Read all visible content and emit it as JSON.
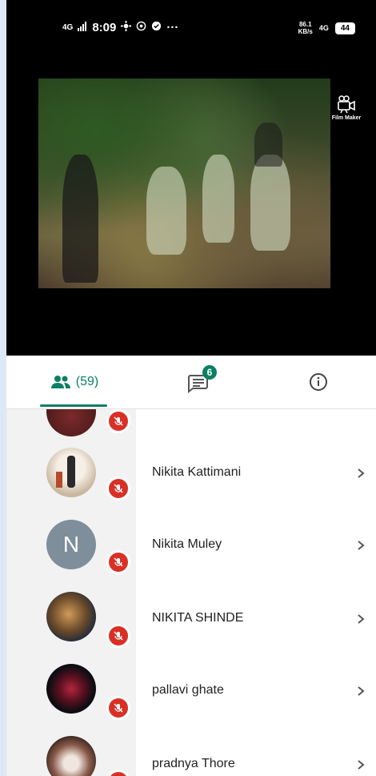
{
  "status_bar": {
    "network": "4G",
    "time": "8:09",
    "more": "···",
    "speed_value": "86.1",
    "speed_unit": "KB/s",
    "network_right": "4G",
    "battery": "44"
  },
  "video": {
    "watermark_label": "Film Maker"
  },
  "tabs": {
    "people_count": "(59)",
    "chat_badge": "6"
  },
  "participants": [
    {
      "name": "",
      "avatar": "photo"
    },
    {
      "name": "Nikita Kattimani",
      "avatar": "photo"
    },
    {
      "name": "Nikita Muley",
      "avatar": "letter",
      "initial": "N"
    },
    {
      "name": "NIKITA SHINDE",
      "avatar": "photo"
    },
    {
      "name": "pallavi ghate",
      "avatar": "photo"
    },
    {
      "name": "pradnya Thore",
      "avatar": "photo"
    }
  ],
  "colors": {
    "accent": "#0b7f63",
    "mic_muted": "#d93025"
  }
}
